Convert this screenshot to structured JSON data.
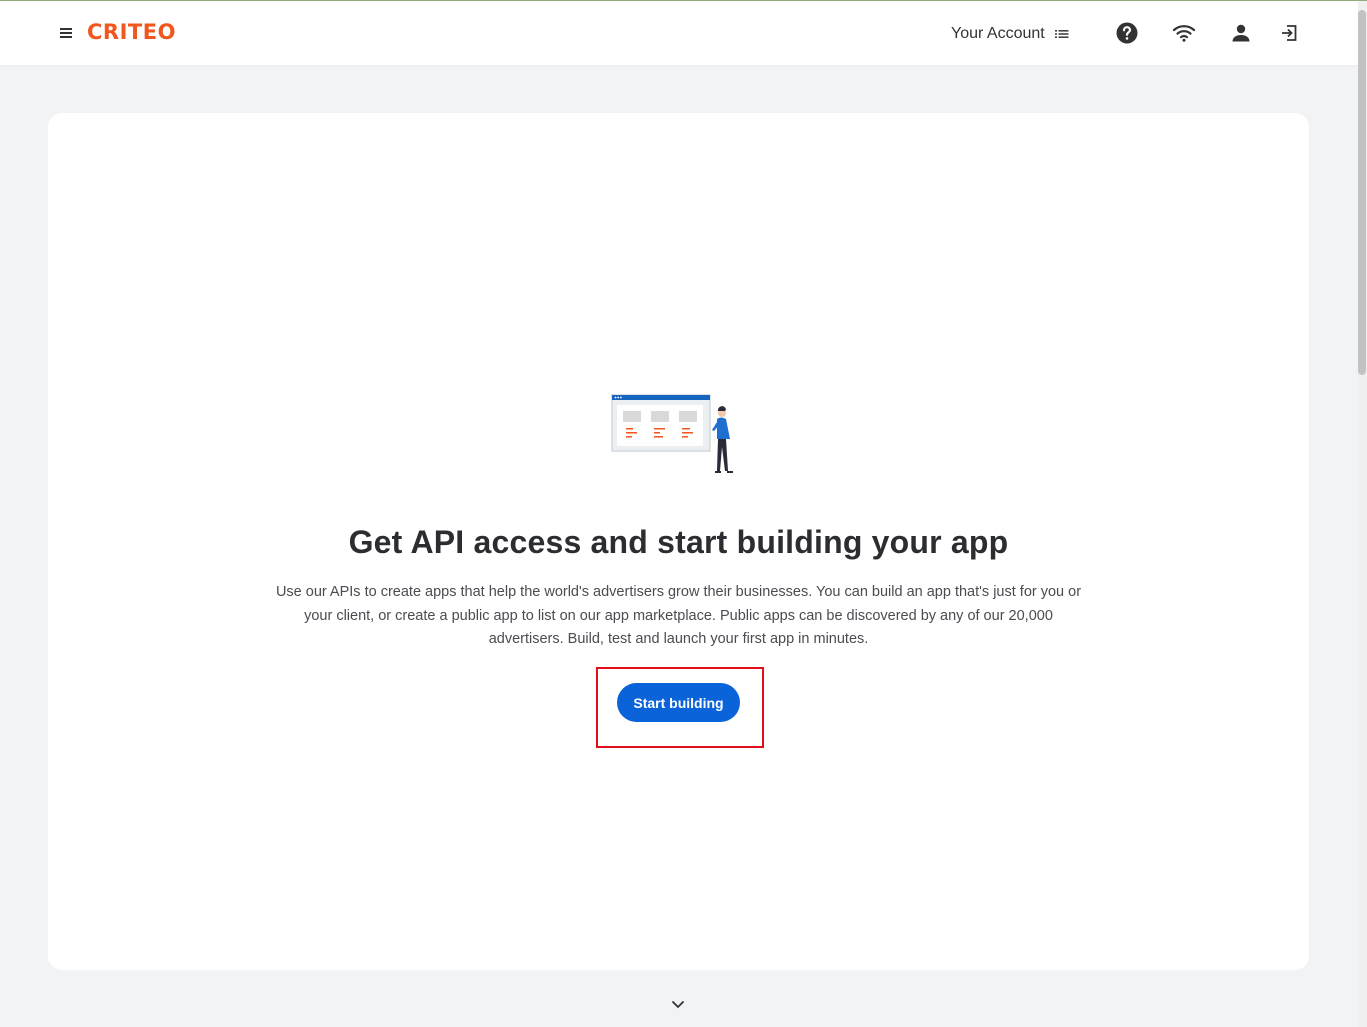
{
  "header": {
    "logo_text": "CRITEO",
    "account_label": "Your Account",
    "icons": [
      "menu-icon",
      "list-icon",
      "help-icon",
      "wifi-icon",
      "user-icon",
      "logout-icon"
    ]
  },
  "main": {
    "title": "Get API access and start building your app",
    "description": "Use our APIs to create apps that help the world's advertisers grow their businesses. You can build an app that's just for you or your client, or create a public app to list on our app marketplace. Public apps can be discovered by any of our 20,000 advertisers. Build, test and launch your first app in minutes.",
    "cta_label": "Start building"
  },
  "colors": {
    "brand": "#f3561d",
    "primary_button": "#0a63d8",
    "highlight_border": "#e0101a"
  }
}
